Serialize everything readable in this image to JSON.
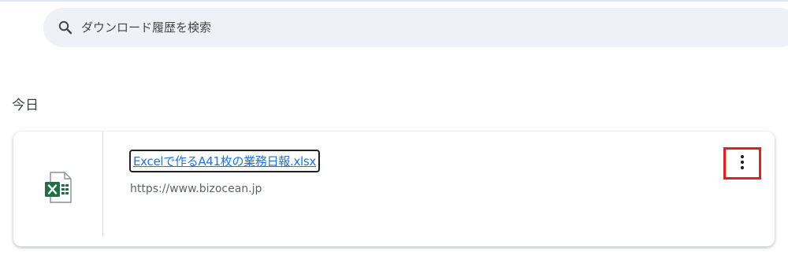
{
  "search": {
    "placeholder": "ダウンロード履歴を検索",
    "value": ""
  },
  "sections": [
    {
      "heading": "今日",
      "items": [
        {
          "file_name": "Excelで作るA41枚の業務日報.xlsx",
          "source_url": "https://www.bizocean.jp",
          "file_icon": "excel-file-icon",
          "menu_icon": "more-vert-icon"
        }
      ]
    }
  ],
  "colors": {
    "link": "#1a73e8",
    "search_bg": "#eef1f7",
    "highlight": "#e2201f",
    "excel_green": "#1e7145"
  }
}
